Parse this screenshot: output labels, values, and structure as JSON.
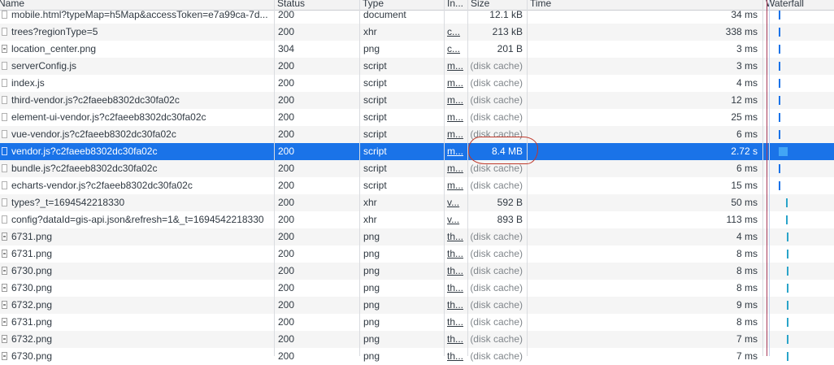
{
  "columns": {
    "name": "Name",
    "status": "Status",
    "type": "Type",
    "initiator": "In...",
    "size": "Size",
    "time": "Time",
    "waterfall": "Waterfall"
  },
  "rows": [
    {
      "name": "mobile.html?typeMap=h5Map&accessToken=e7a99ca-7d...",
      "status": "200",
      "type": "document",
      "initiator": "",
      "size": "12.1 kB",
      "time": "34 ms",
      "icon": "file-icon"
    },
    {
      "name": "trees?regionType=5",
      "status": "200",
      "type": "xhr",
      "initiator": "c...",
      "size": "213 kB",
      "time": "338 ms",
      "icon": "file-icon"
    },
    {
      "name": "location_center.png",
      "status": "304",
      "type": "png",
      "initiator": "c...",
      "size": "201 B",
      "time": "3 ms",
      "icon": "image-icon"
    },
    {
      "name": "serverConfig.js",
      "status": "200",
      "type": "script",
      "initiator": "m...",
      "size": "(disk cache)",
      "time": "3 ms",
      "icon": "file-icon"
    },
    {
      "name": "index.js",
      "status": "200",
      "type": "script",
      "initiator": "m...",
      "size": "(disk cache)",
      "time": "4 ms",
      "icon": "file-icon"
    },
    {
      "name": "third-vendor.js?c2faeeb8302dc30fa02c",
      "status": "200",
      "type": "script",
      "initiator": "m...",
      "size": "(disk cache)",
      "time": "12 ms",
      "icon": "file-icon"
    },
    {
      "name": "element-ui-vendor.js?c2faeeb8302dc30fa02c",
      "status": "200",
      "type": "script",
      "initiator": "m...",
      "size": "(disk cache)",
      "time": "25 ms",
      "icon": "file-icon"
    },
    {
      "name": "vue-vendor.js?c2faeeb8302dc30fa02c",
      "status": "200",
      "type": "script",
      "initiator": "m...",
      "size": "(disk cache)",
      "time": "6 ms",
      "icon": "file-icon"
    },
    {
      "name": "vendor.js?c2faeeb8302dc30fa02c",
      "status": "200",
      "type": "script",
      "initiator": "m...",
      "size": "8.4 MB",
      "time": "2.72 s",
      "icon": "file-icon",
      "selected": true
    },
    {
      "name": "bundle.js?c2faeeb8302dc30fa02c",
      "status": "200",
      "type": "script",
      "initiator": "m...",
      "size": "(disk cache)",
      "time": "6 ms",
      "icon": "file-icon"
    },
    {
      "name": "echarts-vendor.js?c2faeeb8302dc30fa02c",
      "status": "200",
      "type": "script",
      "initiator": "m...",
      "size": "(disk cache)",
      "time": "15 ms",
      "icon": "file-icon"
    },
    {
      "name": "types?_t=1694542218330",
      "status": "200",
      "type": "xhr",
      "initiator": "v...",
      "size": "592 B",
      "time": "50 ms",
      "icon": "file-icon"
    },
    {
      "name": "config?dataId=gis-api.json&refresh=1&_t=1694542218330",
      "status": "200",
      "type": "xhr",
      "initiator": "v...",
      "size": "893 B",
      "time": "113 ms",
      "icon": "file-icon"
    },
    {
      "name": "6731.png",
      "status": "200",
      "type": "png",
      "initiator": "th...",
      "size": "(disk cache)",
      "time": "4 ms",
      "icon": "image-icon"
    },
    {
      "name": "6731.png",
      "status": "200",
      "type": "png",
      "initiator": "th...",
      "size": "(disk cache)",
      "time": "8 ms",
      "icon": "image-icon"
    },
    {
      "name": "6730.png",
      "status": "200",
      "type": "png",
      "initiator": "th...",
      "size": "(disk cache)",
      "time": "8 ms",
      "icon": "image-icon"
    },
    {
      "name": "6730.png",
      "status": "200",
      "type": "png",
      "initiator": "th...",
      "size": "(disk cache)",
      "time": "8 ms",
      "icon": "image-icon"
    },
    {
      "name": "6732.png",
      "status": "200",
      "type": "png",
      "initiator": "th...",
      "size": "(disk cache)",
      "time": "9 ms",
      "icon": "image-icon"
    },
    {
      "name": "6731.png",
      "status": "200",
      "type": "png",
      "initiator": "th...",
      "size": "(disk cache)",
      "time": "8 ms",
      "icon": "image-icon"
    },
    {
      "name": "6732.png",
      "status": "200",
      "type": "png",
      "initiator": "th...",
      "size": "(disk cache)",
      "time": "7 ms",
      "icon": "image-icon"
    },
    {
      "name": "6730.png",
      "status": "200",
      "type": "png",
      "initiator": "th...",
      "size": "(disk cache)",
      "time": "7 ms",
      "icon": "image-icon"
    }
  ],
  "colors": {
    "selected_row": "#1a73e8",
    "annotation": "#c0392b",
    "waterfall_marker": "#a83a5a"
  }
}
